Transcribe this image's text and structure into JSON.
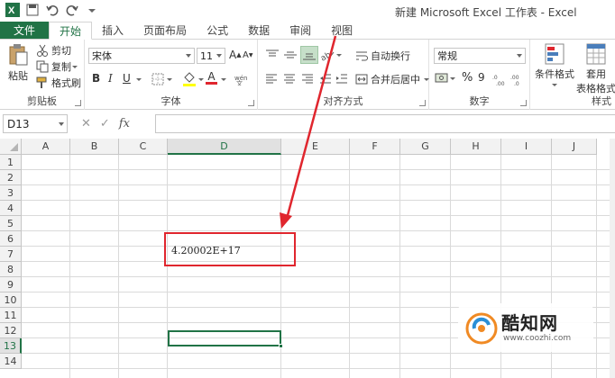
{
  "window": {
    "title": "新建 Microsoft Excel 工作表 - Excel"
  },
  "tabs": [
    "文件",
    "开始",
    "插入",
    "页面布局",
    "公式",
    "数据",
    "审阅",
    "视图"
  ],
  "active_tab": "开始",
  "clipboard": {
    "paste": "粘贴",
    "cut": "剪切",
    "copy": "复制",
    "format_painter": "格式刷",
    "label": "剪贴板"
  },
  "font": {
    "name": "宋体",
    "size": "11",
    "grow": "A",
    "shrink": "A",
    "bold": "B",
    "italic": "I",
    "underline": "U",
    "color_letter": "A",
    "label": "字体"
  },
  "alignment": {
    "wrap_text": "自动换行",
    "merge_center": "合并后居中",
    "label": "对齐方式"
  },
  "number": {
    "format": "常规",
    "percent": "%",
    "comma": "9",
    "label": "数字"
  },
  "styles": {
    "conditional_line1": "条件格式",
    "format_table_line1": "套用",
    "format_table_line2": "表格格式",
    "label": "样式"
  },
  "formula_bar": {
    "name_box": "D13",
    "cancel": "✕",
    "enter": "✓",
    "fx": "fx",
    "value": ""
  },
  "grid": {
    "columns": [
      "A",
      "B",
      "C",
      "D",
      "E",
      "F",
      "G",
      "H",
      "I",
      "J"
    ],
    "rows": [
      "1",
      "2",
      "3",
      "4",
      "5",
      "6",
      "7",
      "8",
      "9",
      "10",
      "11",
      "12",
      "13",
      "14"
    ],
    "selected_column": "D",
    "selected_row": "13",
    "cell_d7_value": "4.20002E+17"
  },
  "watermark": {
    "title": "酷知网",
    "url": "www.coozhi.com"
  },
  "colors": {
    "accent": "#217346",
    "highlight_box": "#e0262e"
  }
}
